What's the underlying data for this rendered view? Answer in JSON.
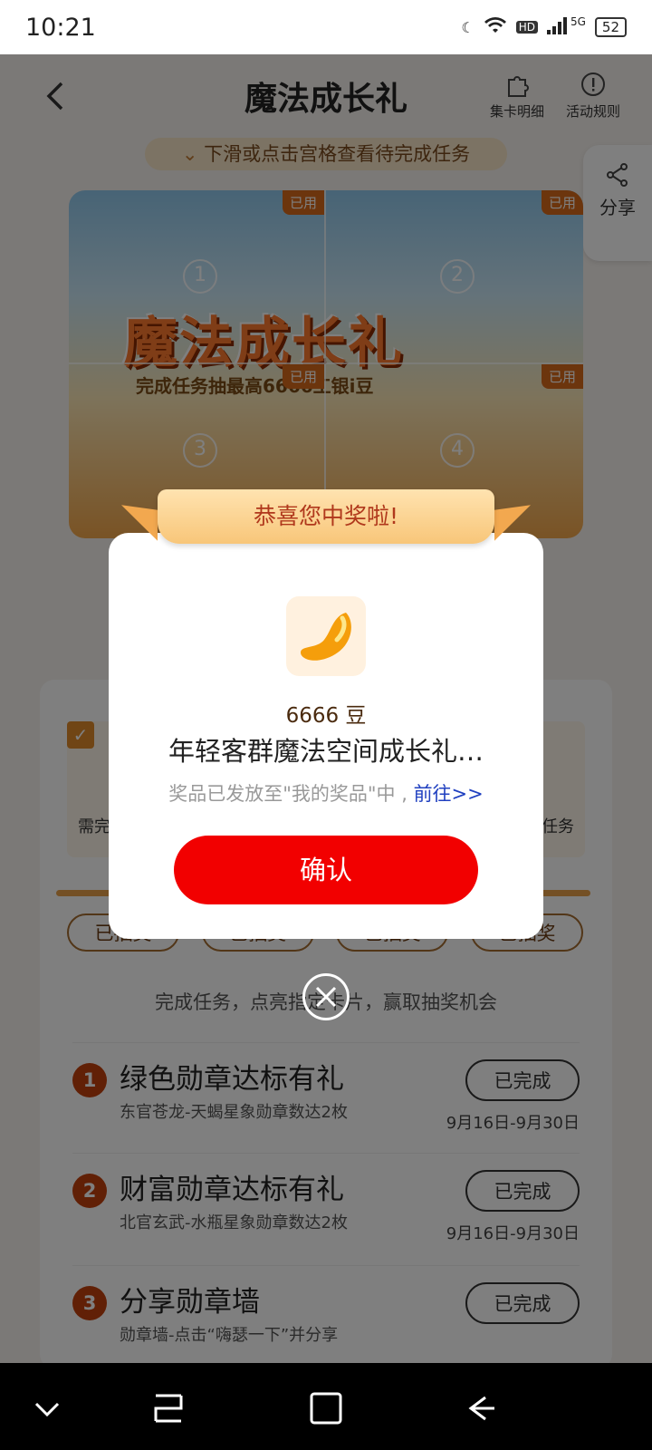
{
  "status": {
    "time": "10:21",
    "network": "5G",
    "hd": "HD",
    "battery": "52"
  },
  "header": {
    "title": "魔法成长礼",
    "card_detail_label": "集卡明细",
    "rules_label": "活动规则",
    "share_label": "分享"
  },
  "hint": "下滑或点击宫格查看待完成任务",
  "grid": {
    "used_label": "已用",
    "art_title": "魔法成长礼",
    "art_subtitle": "完成任务抽最高6666工银i豆",
    "cells": [
      {
        "num": "1"
      },
      {
        "num": "2"
      },
      {
        "num": "3"
      },
      {
        "num": "4"
      }
    ]
  },
  "tasks_card": {
    "left_label": "需完",
    "right_label": "任务",
    "pills": [
      "已抽奖",
      "已抽奖",
      "已抽奖",
      "已抽奖"
    ],
    "instruction": "完成任务，点亮指定卡片，赢取抽奖机会",
    "tasks": [
      {
        "num": "1",
        "name": "绿色勋章达标有礼",
        "desc": "东官苍龙-天蝎星象勋章数达2枚",
        "status": "已完成",
        "date": "9月16日-9月30日"
      },
      {
        "num": "2",
        "name": "财富勋章达标有礼",
        "desc": "北官玄武-水瓶星象勋章数达2枚",
        "status": "已完成",
        "date": "9月16日-9月30日"
      },
      {
        "num": "3",
        "name": "分享勋章墙",
        "desc": "勋章墙-点击“嗨瑟一下”并分享",
        "status": "已完成",
        "date": ""
      }
    ]
  },
  "modal": {
    "ribbon": "恭喜您中奖啦!",
    "amount": "6666 豆",
    "prize_name": "年轻客群魔法空间成长礼…",
    "note": "奖品已发放至\"我的奖品\"中 , ",
    "goto": "前往>>",
    "confirm": "确认"
  },
  "colors": {
    "accent": "#f20000",
    "ribbon": "#f8c679",
    "progress": "#e9a04a"
  }
}
